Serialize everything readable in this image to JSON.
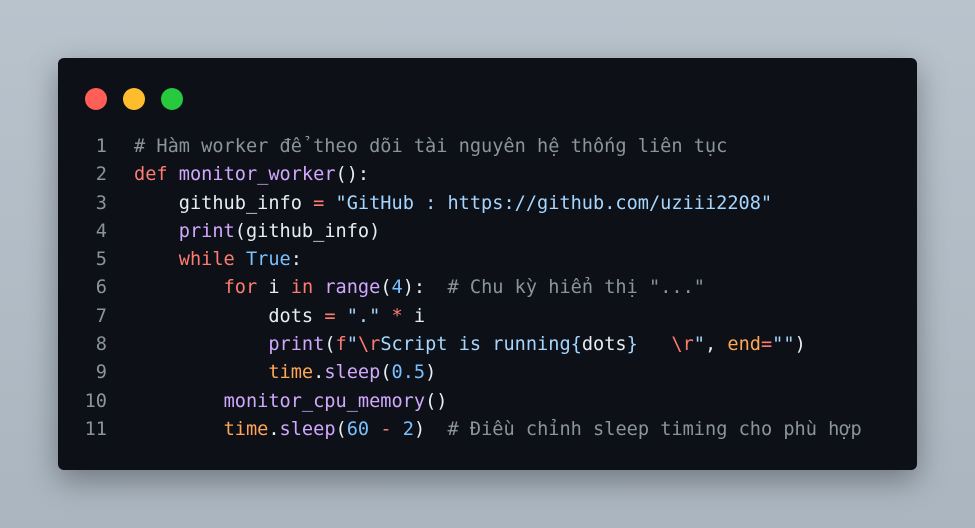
{
  "window": {
    "controls": [
      "close",
      "minimize",
      "maximize"
    ],
    "colors": {
      "red": "#ff5f56",
      "yellow": "#ffbd2e",
      "green": "#27c93f",
      "background": "#0d1117"
    }
  },
  "code": {
    "lines": [
      {
        "n": "1",
        "indent": "",
        "tokens": [
          [
            "cm",
            "# Hàm worker để theo dõi tài nguyên hệ thống liên tục"
          ]
        ]
      },
      {
        "n": "2",
        "indent": "",
        "tokens": [
          [
            "kw",
            "def"
          ],
          [
            "",
            " "
          ],
          [
            "fn",
            "monitor_worker"
          ],
          [
            "",
            "():"
          ]
        ]
      },
      {
        "n": "3",
        "indent": "    ",
        "tokens": [
          [
            "",
            "github_info "
          ],
          [
            "op",
            "="
          ],
          [
            "",
            " "
          ],
          [
            "str",
            "\"GitHub : https://github.com/uziii2208\""
          ]
        ]
      },
      {
        "n": "4",
        "indent": "    ",
        "tokens": [
          [
            "fn",
            "print"
          ],
          [
            "",
            "(github_info)"
          ]
        ]
      },
      {
        "n": "5",
        "indent": "    ",
        "tokens": [
          [
            "kw",
            "while"
          ],
          [
            "",
            " "
          ],
          [
            "num",
            "True"
          ],
          [
            "",
            ":"
          ]
        ]
      },
      {
        "n": "6",
        "indent": "        ",
        "tokens": [
          [
            "kw",
            "for"
          ],
          [
            "",
            " i "
          ],
          [
            "kw",
            "in"
          ],
          [
            "",
            " "
          ],
          [
            "fn",
            "range"
          ],
          [
            "",
            "("
          ],
          [
            "num",
            "4"
          ],
          [
            "",
            "):  "
          ],
          [
            "cm",
            "# Chu kỳ hiển thị \"...\""
          ]
        ]
      },
      {
        "n": "7",
        "indent": "            ",
        "tokens": [
          [
            "",
            "dots "
          ],
          [
            "op",
            "="
          ],
          [
            "",
            " "
          ],
          [
            "str",
            "\".\""
          ],
          [
            "",
            " "
          ],
          [
            "op",
            "*"
          ],
          [
            "",
            " i"
          ]
        ]
      },
      {
        "n": "8",
        "indent": "            ",
        "tokens": [
          [
            "fn",
            "print"
          ],
          [
            "",
            "("
          ],
          [
            "kw",
            "f"
          ],
          [
            "str",
            "\""
          ],
          [
            "kw",
            "\\r"
          ],
          [
            "str",
            "Script is running{"
          ],
          [
            "",
            "dots"
          ],
          [
            "str",
            "}   "
          ],
          [
            "kw",
            "\\r"
          ],
          [
            "str",
            "\""
          ],
          [
            "",
            ", "
          ],
          [
            "mod",
            "end"
          ],
          [
            "op",
            "="
          ],
          [
            "str",
            "\"\""
          ],
          [
            "",
            ")"
          ]
        ]
      },
      {
        "n": "9",
        "indent": "            ",
        "tokens": [
          [
            "mod",
            "time"
          ],
          [
            "",
            "."
          ],
          [
            "fn",
            "sleep"
          ],
          [
            "",
            "("
          ],
          [
            "num",
            "0.5"
          ],
          [
            "",
            ")"
          ]
        ]
      },
      {
        "n": "10",
        "indent": "        ",
        "tokens": [
          [
            "fn",
            "monitor_cpu_memory"
          ],
          [
            "",
            "()"
          ]
        ]
      },
      {
        "n": "11",
        "indent": "        ",
        "tokens": [
          [
            "mod",
            "time"
          ],
          [
            "",
            "."
          ],
          [
            "fn",
            "sleep"
          ],
          [
            "",
            "("
          ],
          [
            "num",
            "60"
          ],
          [
            "",
            " "
          ],
          [
            "op",
            "-"
          ],
          [
            "",
            " "
          ],
          [
            "num",
            "2"
          ],
          [
            "",
            ")  "
          ],
          [
            "cm",
            "# Điều chỉnh sleep timing cho phù hợp"
          ]
        ]
      }
    ]
  }
}
